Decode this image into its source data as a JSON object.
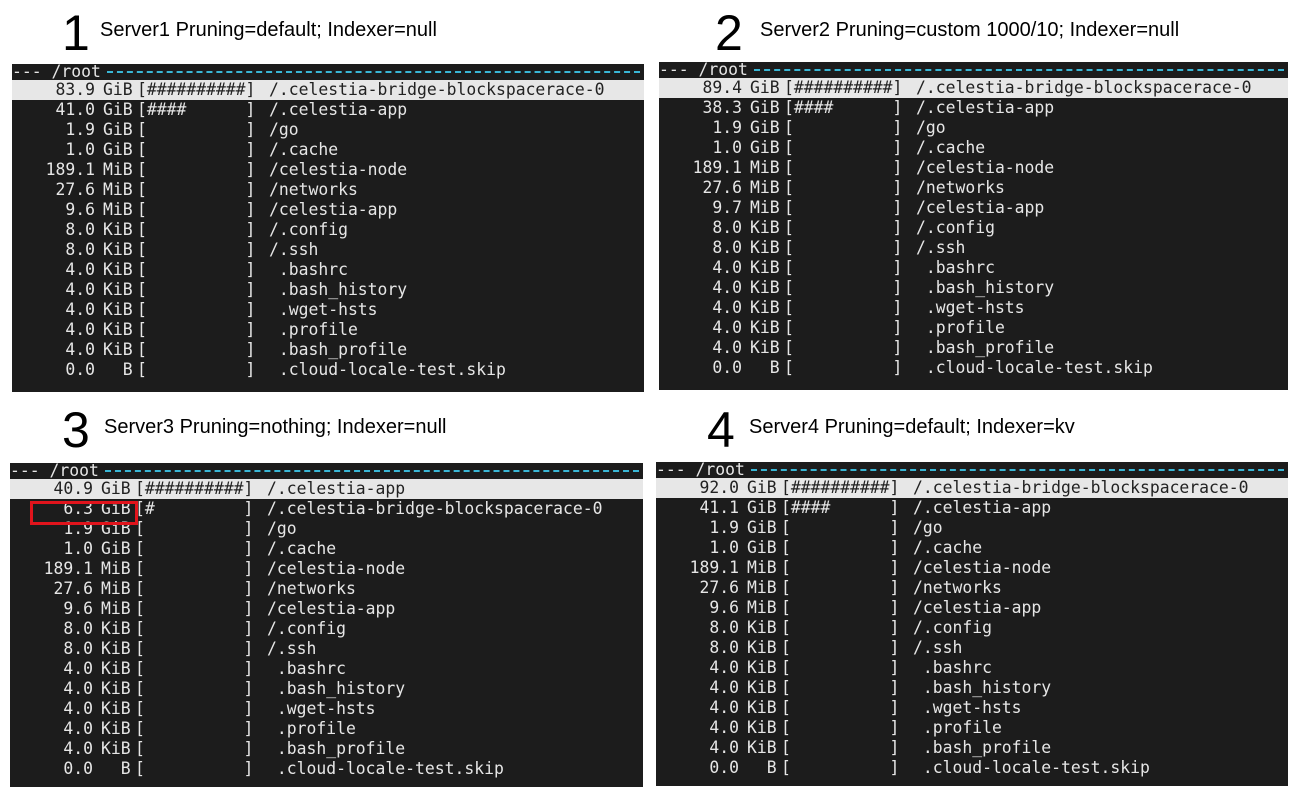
{
  "panels": [
    {
      "number": "1",
      "title": "Server1 Pruning=default; Indexer=null",
      "header_path": "--- /root",
      "rows": [
        {
          "size": "83.9",
          "unit": "GiB",
          "bar": "[##########]",
          "path": "/.celestia-bridge-blockspacerace-0",
          "selected": true
        },
        {
          "size": "41.0",
          "unit": "GiB",
          "bar": "[####      ]",
          "path": "/.celestia-app"
        },
        {
          "size": "1.9",
          "unit": "GiB",
          "bar": "[          ]",
          "path": "/go"
        },
        {
          "size": "1.0",
          "unit": "GiB",
          "bar": "[          ]",
          "path": "/.cache"
        },
        {
          "size": "189.1",
          "unit": "MiB",
          "bar": "[          ]",
          "path": "/celestia-node"
        },
        {
          "size": "27.6",
          "unit": "MiB",
          "bar": "[          ]",
          "path": "/networks"
        },
        {
          "size": "9.6",
          "unit": "MiB",
          "bar": "[          ]",
          "path": "/celestia-app"
        },
        {
          "size": "8.0",
          "unit": "KiB",
          "bar": "[          ]",
          "path": "/.config"
        },
        {
          "size": "8.0",
          "unit": "KiB",
          "bar": "[          ]",
          "path": "/.ssh"
        },
        {
          "size": "4.0",
          "unit": "KiB",
          "bar": "[          ]",
          "path": " .bashrc"
        },
        {
          "size": "4.0",
          "unit": "KiB",
          "bar": "[          ]",
          "path": " .bash_history"
        },
        {
          "size": "4.0",
          "unit": "KiB",
          "bar": "[          ]",
          "path": " .wget-hsts"
        },
        {
          "size": "4.0",
          "unit": "KiB",
          "bar": "[          ]",
          "path": " .profile"
        },
        {
          "size": "4.0",
          "unit": "KiB",
          "bar": "[          ]",
          "path": " .bash_profile"
        },
        {
          "size": "0.0",
          "unit": "  B",
          "bar": "[          ]",
          "path": " .cloud-locale-test.skip"
        }
      ]
    },
    {
      "number": "2",
      "title": "Server2 Pruning=custom 1000/10; Indexer=null",
      "header_path": "--- /root",
      "rows": [
        {
          "size": "89.4",
          "unit": "GiB",
          "bar": "[##########]",
          "path": "/.celestia-bridge-blockspacerace-0",
          "selected": true
        },
        {
          "size": "38.3",
          "unit": "GiB",
          "bar": "[####      ]",
          "path": "/.celestia-app"
        },
        {
          "size": "1.9",
          "unit": "GiB",
          "bar": "[          ]",
          "path": "/go"
        },
        {
          "size": "1.0",
          "unit": "GiB",
          "bar": "[          ]",
          "path": "/.cache"
        },
        {
          "size": "189.1",
          "unit": "MiB",
          "bar": "[          ]",
          "path": "/celestia-node"
        },
        {
          "size": "27.6",
          "unit": "MiB",
          "bar": "[          ]",
          "path": "/networks"
        },
        {
          "size": "9.7",
          "unit": "MiB",
          "bar": "[          ]",
          "path": "/celestia-app"
        },
        {
          "size": "8.0",
          "unit": "KiB",
          "bar": "[          ]",
          "path": "/.config"
        },
        {
          "size": "8.0",
          "unit": "KiB",
          "bar": "[          ]",
          "path": "/.ssh"
        },
        {
          "size": "4.0",
          "unit": "KiB",
          "bar": "[          ]",
          "path": " .bashrc"
        },
        {
          "size": "4.0",
          "unit": "KiB",
          "bar": "[          ]",
          "path": " .bash_history"
        },
        {
          "size": "4.0",
          "unit": "KiB",
          "bar": "[          ]",
          "path": " .wget-hsts"
        },
        {
          "size": "4.0",
          "unit": "KiB",
          "bar": "[          ]",
          "path": " .profile"
        },
        {
          "size": "4.0",
          "unit": "KiB",
          "bar": "[          ]",
          "path": " .bash_profile"
        },
        {
          "size": "0.0",
          "unit": "  B",
          "bar": "[          ]",
          "path": " .cloud-locale-test.skip"
        }
      ]
    },
    {
      "number": "3",
      "title": "Server3 Pruning=nothing; Indexer=null",
      "header_path": "--- /root",
      "rows": [
        {
          "size": "40.9",
          "unit": "GiB",
          "bar": "[##########]",
          "path": "/.celestia-app",
          "selected": true
        },
        {
          "size": "6.3",
          "unit": "GiB",
          "bar": "[#         ]",
          "path": "/.celestia-bridge-blockspacerace-0",
          "highlight": true
        },
        {
          "size": "1.9",
          "unit": "GiB",
          "bar": "[          ]",
          "path": "/go"
        },
        {
          "size": "1.0",
          "unit": "GiB",
          "bar": "[          ]",
          "path": "/.cache"
        },
        {
          "size": "189.1",
          "unit": "MiB",
          "bar": "[          ]",
          "path": "/celestia-node"
        },
        {
          "size": "27.6",
          "unit": "MiB",
          "bar": "[          ]",
          "path": "/networks"
        },
        {
          "size": "9.6",
          "unit": "MiB",
          "bar": "[          ]",
          "path": "/celestia-app"
        },
        {
          "size": "8.0",
          "unit": "KiB",
          "bar": "[          ]",
          "path": "/.config"
        },
        {
          "size": "8.0",
          "unit": "KiB",
          "bar": "[          ]",
          "path": "/.ssh"
        },
        {
          "size": "4.0",
          "unit": "KiB",
          "bar": "[          ]",
          "path": " .bashrc"
        },
        {
          "size": "4.0",
          "unit": "KiB",
          "bar": "[          ]",
          "path": " .bash_history"
        },
        {
          "size": "4.0",
          "unit": "KiB",
          "bar": "[          ]",
          "path": " .wget-hsts"
        },
        {
          "size": "4.0",
          "unit": "KiB",
          "bar": "[          ]",
          "path": " .profile"
        },
        {
          "size": "4.0",
          "unit": "KiB",
          "bar": "[          ]",
          "path": " .bash_profile"
        },
        {
          "size": "0.0",
          "unit": "  B",
          "bar": "[          ]",
          "path": " .cloud-locale-test.skip"
        }
      ]
    },
    {
      "number": "4",
      "title": "Server4 Pruning=default; Indexer=kv",
      "header_path": "--- /root",
      "rows": [
        {
          "size": "92.0",
          "unit": "GiB",
          "bar": "[##########]",
          "path": "/.celestia-bridge-blockspacerace-0",
          "selected": true
        },
        {
          "size": "41.1",
          "unit": "GiB",
          "bar": "[####      ]",
          "path": "/.celestia-app"
        },
        {
          "size": "1.9",
          "unit": "GiB",
          "bar": "[          ]",
          "path": "/go"
        },
        {
          "size": "1.0",
          "unit": "GiB",
          "bar": "[          ]",
          "path": "/.cache"
        },
        {
          "size": "189.1",
          "unit": "MiB",
          "bar": "[          ]",
          "path": "/celestia-node"
        },
        {
          "size": "27.6",
          "unit": "MiB",
          "bar": "[          ]",
          "path": "/networks"
        },
        {
          "size": "9.6",
          "unit": "MiB",
          "bar": "[          ]",
          "path": "/celestia-app"
        },
        {
          "size": "8.0",
          "unit": "KiB",
          "bar": "[          ]",
          "path": "/.config"
        },
        {
          "size": "8.0",
          "unit": "KiB",
          "bar": "[          ]",
          "path": "/.ssh"
        },
        {
          "size": "4.0",
          "unit": "KiB",
          "bar": "[          ]",
          "path": " .bashrc"
        },
        {
          "size": "4.0",
          "unit": "KiB",
          "bar": "[          ]",
          "path": " .bash_history"
        },
        {
          "size": "4.0",
          "unit": "KiB",
          "bar": "[          ]",
          "path": " .wget-hsts"
        },
        {
          "size": "4.0",
          "unit": "KiB",
          "bar": "[          ]",
          "path": " .profile"
        },
        {
          "size": "4.0",
          "unit": "KiB",
          "bar": "[          ]",
          "path": " .bash_profile"
        },
        {
          "size": "0.0",
          "unit": "  B",
          "bar": "[          ]",
          "path": " .cloud-locale-test.skip"
        }
      ]
    }
  ],
  "colors": {
    "terminal_bg": "#1c1c1c",
    "terminal_fg": "#e6e6e6",
    "header_dash": "#39b7d6",
    "selected_bg": "#e7e7e7",
    "highlight_box": "#e0141c"
  }
}
